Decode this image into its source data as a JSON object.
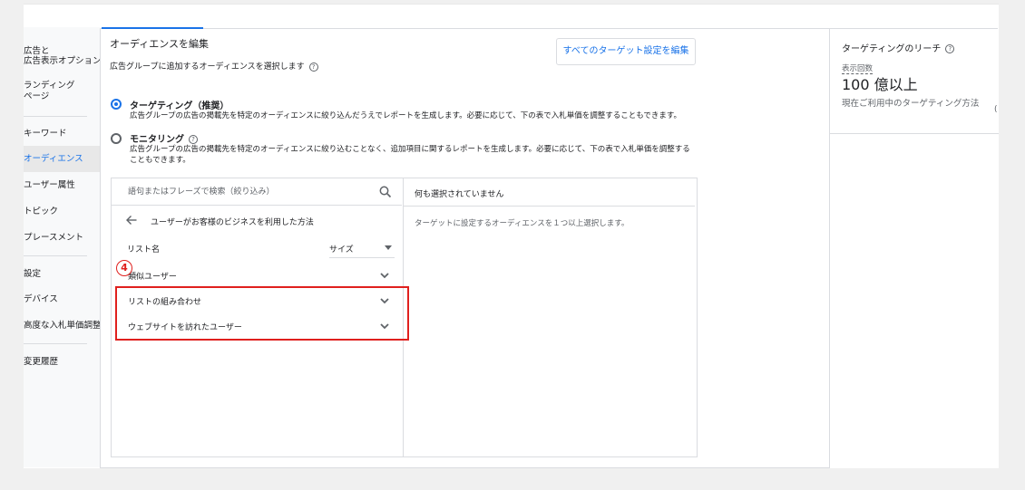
{
  "nav": {
    "items": [
      {
        "label": "広告と"
      },
      {
        "label": "広告表示オプション"
      },
      {
        "label": "ランディング"
      },
      {
        "label": "ページ"
      },
      {
        "label": "キーワード"
      },
      {
        "label": "オーディエンス"
      },
      {
        "label": "ユーザー属性"
      },
      {
        "label": "トピック"
      },
      {
        "label": "プレースメント"
      },
      {
        "label": "設定"
      },
      {
        "label": "デバイス"
      },
      {
        "label": "高度な入札単価調整"
      },
      {
        "label": "変更履歴"
      }
    ],
    "active": "オーディエンス"
  },
  "editor": {
    "title": "オーディエンスを編集",
    "subtitle": "広告グループに追加するオーディエンスを選択します",
    "edit_all_button": "すべてのターゲット設定を編集",
    "options": [
      {
        "title": "ターゲティング（推奨）",
        "desc": "広告グループの広告の掲載先を特定のオーディエンスに絞り込んだうえでレポートを生成します。必要に応じて、下の表で入札単価を調整することもできます。",
        "selected": true
      },
      {
        "title": "モニタリング",
        "desc": "広告グループの広告の掲載先を特定のオーディエンスに絞り込むことなく、追加項目に関するレポートを生成します。必要に応じて、下の表で入札単価を調整することもできます。",
        "selected": false
      }
    ]
  },
  "selector": {
    "search_placeholder": "語句またはフレーズで検索（絞り込み）",
    "back_label": "ユーザーがお客様のビジネスを利用した方法",
    "list_header": "リスト名",
    "size_label": "サイズ",
    "rows": [
      {
        "label": "類似ユーザー"
      },
      {
        "label": "リストの組み合わせ"
      },
      {
        "label": "ウェブサイトを訪れたユーザー"
      }
    ],
    "right_title": "何も選択されていません",
    "right_empty": "ターゲットに設定するオーディエンスを１つ以上選択します。"
  },
  "annotation": {
    "step": "4",
    "color": "#e0201e"
  },
  "reach": {
    "title": "ターゲティングのリーチ",
    "label": "表示回数",
    "value": "100 億以上",
    "note": "現在ご利用中のターゲティング方法"
  },
  "colors": {
    "accent": "#1a73e8",
    "highlight": "#e0201e"
  }
}
